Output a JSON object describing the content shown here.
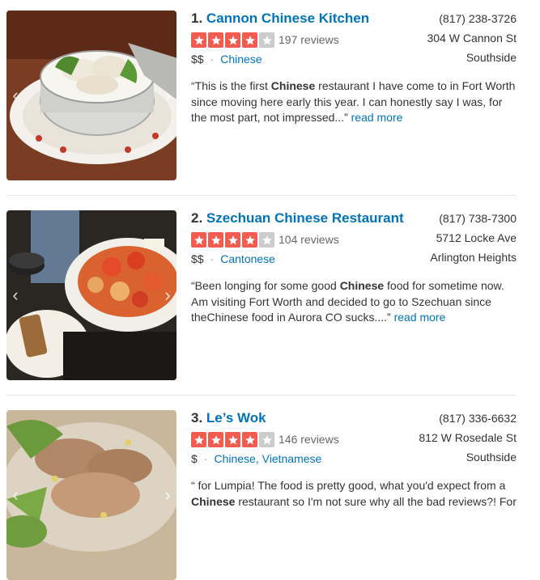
{
  "results": [
    {
      "rank": "1.",
      "name": "Cannon Chinese Kitchen",
      "stars": 4,
      "reviews": "197 reviews",
      "price": "$$",
      "categories": [
        "Chinese"
      ],
      "phone": "(817) 238-3726",
      "address": "304 W Cannon St",
      "neighborhood": "Southside",
      "snippet_before": "“This is the first ",
      "snippet_bold": "Chinese",
      "snippet_after": " restaurant I have come to in Fort Worth since moving here early this year. I can honestly say I was, for the most part, not impressed...” ",
      "read_more": "read more"
    },
    {
      "rank": "2.",
      "name": "Szechuan Chinese Restaurant",
      "stars": 4,
      "reviews": "104 reviews",
      "price": "$$",
      "categories": [
        "Cantonese"
      ],
      "phone": "(817) 738-7300",
      "address": "5712 Locke Ave",
      "neighborhood": "Arlington Heights",
      "snippet_before": "“Been longing for some good ",
      "snippet_bold": "Chinese",
      "snippet_after": " food for sometime now. Am visiting Fort Worth and decided to go to Szechuan since theChinese food in Aurora CO sucks....” ",
      "read_more": "read more"
    },
    {
      "rank": "3.",
      "name": "Le’s Wok",
      "stars": 4,
      "reviews": "146 reviews",
      "price": "$",
      "categories": [
        "Chinese,",
        "Vietnamese"
      ],
      "phone": "(817) 336-6632",
      "address": "812 W Rosedale St",
      "neighborhood": "Southside",
      "snippet_line1": "“ for Lumpia! The food is pretty good, what you'd expect from a",
      "snippet_bold": "Chinese",
      "snippet_after": " restaurant so I'm not sure why all the bad reviews?! For"
    }
  ],
  "colors": {
    "link": "#0073bb",
    "star_on": "#f15c4f",
    "star_off": "#cccccc"
  }
}
